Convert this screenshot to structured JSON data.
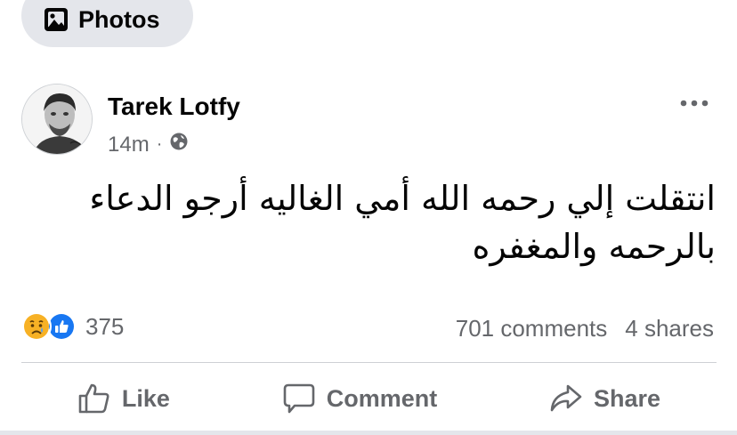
{
  "filter": {
    "label": "Photos",
    "icon": "photo-gallery-icon"
  },
  "post": {
    "author": "Tarek Lotfy",
    "time": "14m",
    "separator": "·",
    "audience_icon": "globe-icon",
    "more_icon": "more-horizontal-icon",
    "text_line1": "انتقلت إلي رحمه الله أمي الغاليه أرجو الدعاء",
    "text_line2": "بالرحمه والمغفره"
  },
  "reactions": {
    "icons": [
      "sad-reaction-icon",
      "like-reaction-icon"
    ],
    "count": "375"
  },
  "stats": {
    "comments": "701 comments",
    "shares": "4 shares"
  },
  "actions": [
    {
      "label": "Like",
      "icon": "thumbs-up-icon"
    },
    {
      "label": "Comment",
      "icon": "comment-icon"
    },
    {
      "label": "Share",
      "icon": "share-icon"
    }
  ],
  "colors": {
    "text": "#050505",
    "secondary": "#65676b",
    "pill_bg": "#e4e6eb",
    "like_blue": "#1877f2",
    "sad_yellow": "#f7b125"
  }
}
